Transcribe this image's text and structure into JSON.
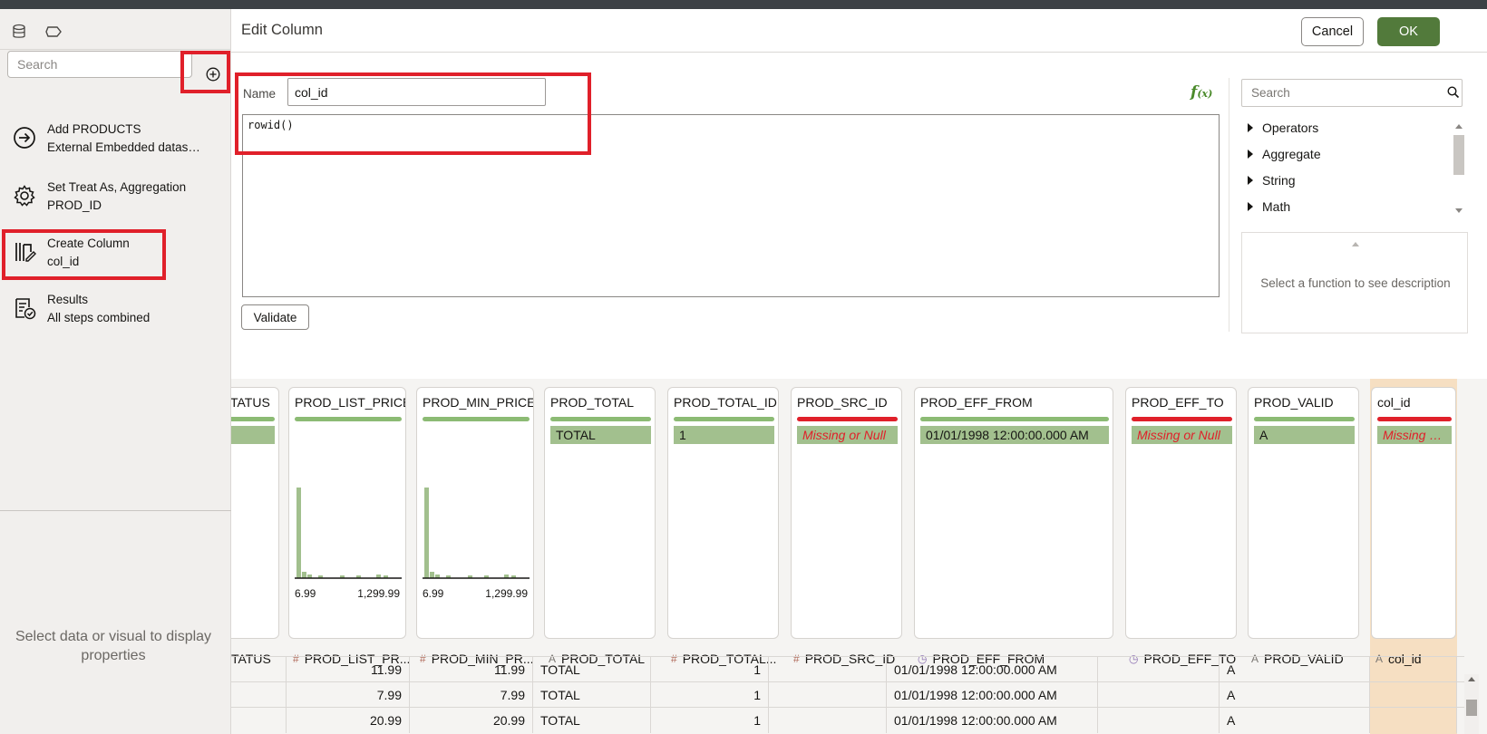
{
  "left_panel": {
    "search_placeholder": "Search",
    "steps": [
      {
        "title": "Add PRODUCTS",
        "subtitle": "External Embedded datas…"
      },
      {
        "title": "Set Treat As, Aggregation",
        "subtitle": "PROD_ID"
      },
      {
        "title": "Create Column",
        "subtitle": "col_id"
      },
      {
        "title": "Results",
        "subtitle": "All steps combined"
      }
    ],
    "properties_hint": "Select data or visual to display properties"
  },
  "editor": {
    "title": "Edit Column",
    "cancel_label": "Cancel",
    "ok_label": "OK",
    "name_label": "Name",
    "name_value": "col_id",
    "expression": "rowid()",
    "validate_label": "Validate"
  },
  "functions": {
    "search_placeholder": "Search",
    "categories": [
      "Operators",
      "Aggregate",
      "String",
      "Math"
    ],
    "description_hint": "Select a function to see description"
  },
  "columns": [
    {
      "title": "TATUS",
      "header": "TATUS",
      "type": "",
      "value": "",
      "quality": "good"
    },
    {
      "title": "PROD_LIST_PRICE",
      "header": "PROD_LIST_PR...",
      "type": "#",
      "value": "",
      "quality": "good",
      "hist": {
        "min": "6.99",
        "max": "1,299.99"
      }
    },
    {
      "title": "PROD_MIN_PRICE",
      "header": "PROD_MIN_PR...",
      "type": "#",
      "value": "",
      "quality": "good",
      "hist": {
        "min": "6.99",
        "max": "1,299.99"
      }
    },
    {
      "title": "PROD_TOTAL",
      "header": "PROD_TOTAL",
      "type": "A",
      "value": "TOTAL",
      "quality": "good"
    },
    {
      "title": "PROD_TOTAL_ID",
      "header": "PROD_TOTAL...",
      "type": "#",
      "value": "1",
      "quality": "good"
    },
    {
      "title": "PROD_SRC_ID",
      "header": "PROD_SRC_ID",
      "type": "#",
      "value": "Missing or Null",
      "quality": "bad"
    },
    {
      "title": "PROD_EFF_FROM",
      "header": "PROD_EFF_FROM",
      "type": "clock",
      "value": "01/01/1998 12:00:00.000 AM",
      "quality": "good"
    },
    {
      "title": "PROD_EFF_TO",
      "header": "PROD_EFF_TO",
      "type": "clock",
      "value": "Missing or Null",
      "quality": "bad"
    },
    {
      "title": "PROD_VALID",
      "header": "PROD_VALID",
      "type": "A",
      "value": "A",
      "quality": "good"
    },
    {
      "title": "col_id",
      "header": "col_id",
      "type": "A",
      "value": "Missing o...",
      "quality": "bad"
    }
  ],
  "rows": [
    [
      "",
      "11.99",
      "11.99",
      "TOTAL",
      "1",
      "",
      "01/01/1998 12:00:00.000 AM",
      "",
      "A",
      ""
    ],
    [
      "",
      "7.99",
      "7.99",
      "TOTAL",
      "1",
      "",
      "01/01/1998 12:00:00.000 AM",
      "",
      "A",
      ""
    ],
    [
      "",
      "20.99",
      "20.99",
      "TOTAL",
      "1",
      "",
      "01/01/1998 12:00:00.000 AM",
      "",
      "A",
      ""
    ]
  ],
  "colors": {
    "accent": "#527a3b",
    "good": "#8cbb74",
    "bad": "#e0202a",
    "highlight": "#e0202a",
    "selected_column": "#f6dfc2"
  }
}
